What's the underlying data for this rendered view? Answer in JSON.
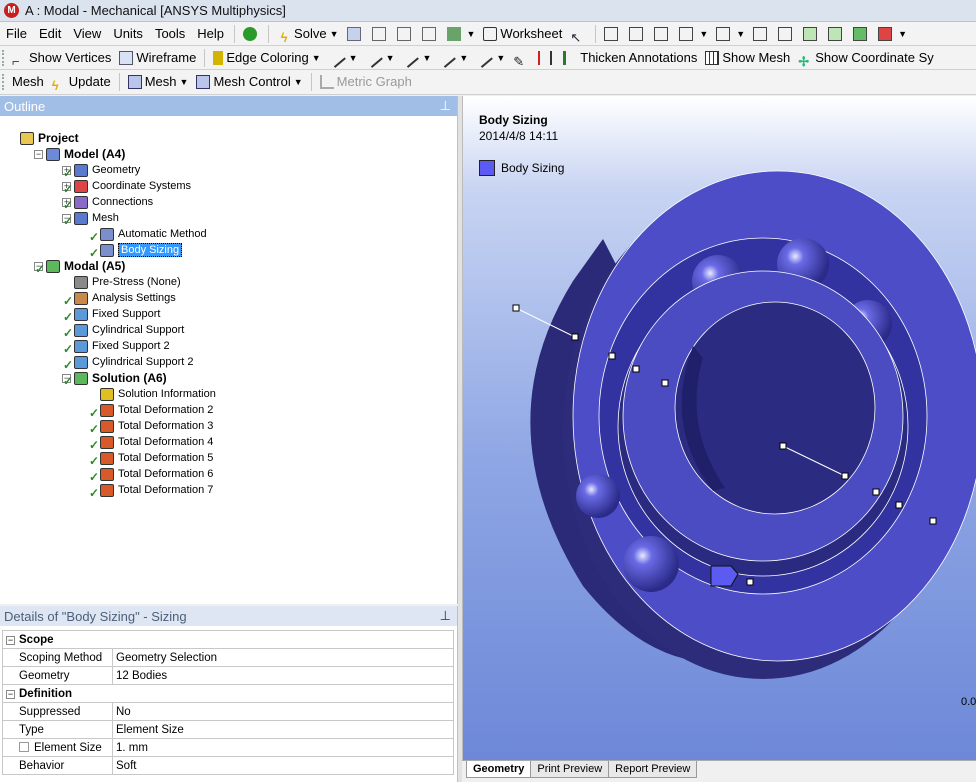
{
  "window": {
    "title": "A : Modal - Mechanical [ANSYS Multiphysics]",
    "logo_letter": "M"
  },
  "menubar": {
    "items": [
      "File",
      "Edit",
      "View",
      "Units",
      "Tools",
      "Help"
    ],
    "solve_label": "Solve",
    "worksheet_label": "Worksheet"
  },
  "toolbar2": {
    "show_vertices": "Show Vertices",
    "wireframe": "Wireframe",
    "edge_coloring": "Edge Coloring",
    "thicken_annotations": "Thicken Annotations",
    "show_mesh": "Show Mesh",
    "show_coordinate": "Show Coordinate Sy"
  },
  "toolbar3": {
    "mesh_label": "Mesh",
    "update": "Update",
    "mesh_dd": "Mesh",
    "mesh_control": "Mesh Control",
    "metric_graph": "Metric Graph"
  },
  "outline": {
    "title": "Outline",
    "nodes": [
      {
        "label": "Project",
        "bold": true
      },
      {
        "label": "Model (A4)",
        "bold": true
      },
      {
        "label": "Geometry"
      },
      {
        "label": "Coordinate Systems"
      },
      {
        "label": "Connections"
      },
      {
        "label": "Mesh"
      },
      {
        "label": "Automatic Method"
      },
      {
        "label": "Body Sizing",
        "selected": true
      },
      {
        "label": "Modal (A5)",
        "bold": true
      },
      {
        "label": "Pre-Stress (None)"
      },
      {
        "label": "Analysis Settings"
      },
      {
        "label": "Fixed Support"
      },
      {
        "label": "Cylindrical Support"
      },
      {
        "label": "Fixed Support 2"
      },
      {
        "label": "Cylindrical Support 2"
      },
      {
        "label": "Solution (A6)",
        "bold": true
      },
      {
        "label": "Solution Information"
      },
      {
        "label": "Total Deformation 2"
      },
      {
        "label": "Total Deformation 3"
      },
      {
        "label": "Total Deformation 4"
      },
      {
        "label": "Total Deformation 5"
      },
      {
        "label": "Total Deformation 6"
      },
      {
        "label": "Total Deformation 7"
      }
    ]
  },
  "details": {
    "title": "Details of \"Body Sizing\" - Sizing",
    "groups": [
      {
        "name": "Scope",
        "rows": [
          [
            "Scoping Method",
            "Geometry Selection"
          ],
          [
            "Geometry",
            "12 Bodies"
          ]
        ]
      },
      {
        "name": "Definition",
        "rows": [
          [
            "Suppressed",
            "No"
          ],
          [
            "Type",
            "Element Size"
          ],
          [
            "Element Size",
            "1. mm"
          ],
          [
            "Behavior",
            "Soft"
          ]
        ]
      }
    ]
  },
  "viewport": {
    "title": "Body Sizing",
    "date": "2014/4/8 14:11",
    "legend": "Body Sizing",
    "scale_label": "0.0",
    "colors": {
      "body": "#4f4fcf",
      "legend": "#5b5bf2"
    }
  },
  "tabs": [
    "Geometry",
    "Print Preview",
    "Report Preview"
  ]
}
